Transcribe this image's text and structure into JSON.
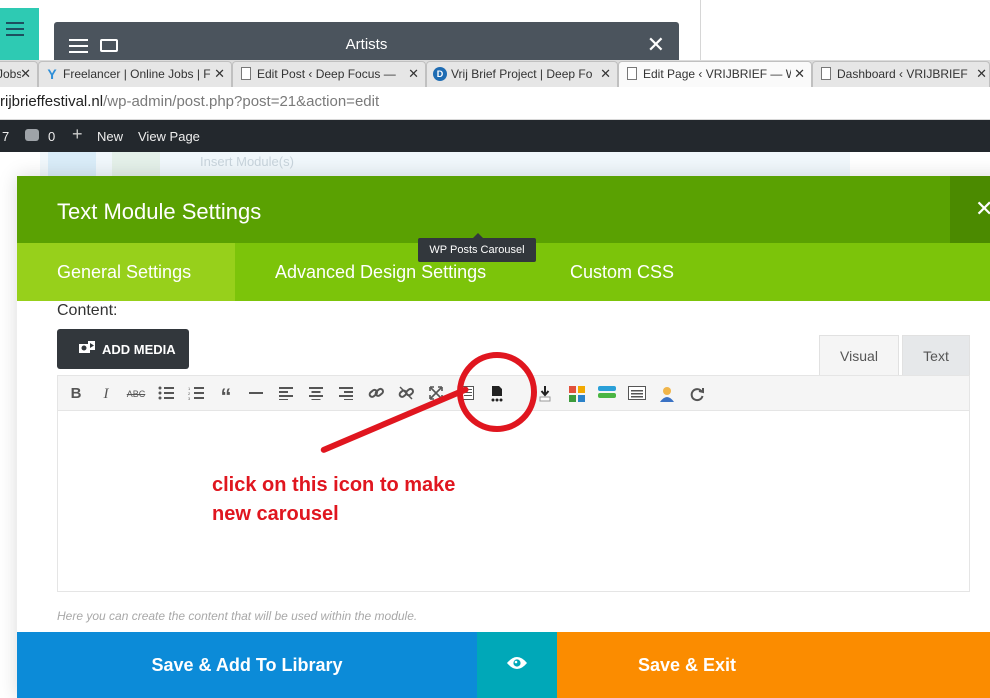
{
  "background": {
    "artists_title": "Artists",
    "insert_modules_text": "Insert Module(s)"
  },
  "browser": {
    "tabs": [
      {
        "label": "Jobs",
        "icon": "page-icon"
      },
      {
        "label": "Freelancer | Online Jobs | F",
        "icon": "freelancer-icon"
      },
      {
        "label": "Edit Post ‹ Deep Focus —",
        "icon": "page-icon"
      },
      {
        "label": "Vrij Brief Project | Deep Fo",
        "icon": "deepfocus-icon"
      },
      {
        "label": "Edit Page ‹ VRIJBRIEF — W",
        "icon": "page-icon",
        "active": true
      },
      {
        "label": "Dashboard ‹ VRIJBRIEF —",
        "icon": "page-icon"
      }
    ],
    "url_host": "rijbrieffestival.nl",
    "url_path": "/wp-admin/post.php?post=21&action=edit"
  },
  "admin_bar": {
    "updates_count": "7",
    "comments_count": "0",
    "new_label": "New",
    "view_page_label": "View Page"
  },
  "modal": {
    "title": "Text Module Settings",
    "tabs": [
      "General Settings",
      "Advanced Design Settings",
      "Custom CSS"
    ],
    "content_label": "Content:",
    "add_media_label": "ADD MEDIA",
    "editor_tabs": {
      "visual": "Visual",
      "text": "Text"
    },
    "tooltip": "WP Posts Carousel",
    "help_text": "Here you can create the content that will be used within the module.",
    "footer": {
      "save_library": "Save & Add To Library",
      "save_exit": "Save & Exit"
    }
  },
  "annotation": {
    "line1": "click on this icon to make",
    "line2": "new carousel",
    "color": "#e0161f"
  },
  "colors": {
    "header_green": "#5aa102",
    "tab_green": "#7cc40a",
    "active_tab_green": "#97d01b",
    "save_blue": "#0c8bd8",
    "preview_teal": "#00a8b8",
    "save_orange": "#fb8c00"
  }
}
